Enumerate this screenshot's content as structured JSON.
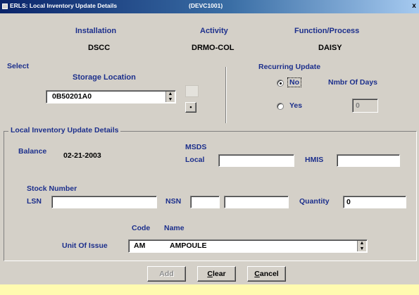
{
  "window": {
    "title": "ERLS: Local Inventory Update Details",
    "code": "(DEVC1001)",
    "close_glyph": "x"
  },
  "header": {
    "installation_label": "Installation",
    "installation_value": "DSCC",
    "activity_label": "Activity",
    "activity_value": "DRMO-COL",
    "function_label": "Function/Process",
    "function_value": "DAISY"
  },
  "select": {
    "group_label": "Select",
    "storage_label": "Storage Location",
    "storage_value": "0B50201A0",
    "more_button_glyph": "•"
  },
  "recurring": {
    "label": "Recurring Update",
    "no_label": "No",
    "yes_label": "Yes",
    "selected": "No",
    "days_label": "Nmbr Of Days",
    "days_value": "0"
  },
  "details": {
    "group_label": "Local Inventory Update Details",
    "balance_label": "Balance",
    "balance_value": "02-21-2003",
    "msds_label": "MSDS",
    "local_label": "Local",
    "local_value": "",
    "hmis_label": "HMIS",
    "hmis_value": "",
    "stock_number_label": "Stock Number",
    "lsn_label": "LSN",
    "lsn_value": "",
    "nsn_label": "NSN",
    "nsn_value_a": "",
    "nsn_value_b": "",
    "quantity_label": "Quantity",
    "quantity_value": "0",
    "code_label": "Code",
    "name_label": "Name",
    "unit_label": "Unit Of Issue",
    "unit_code": "AM",
    "unit_name": "AMPOULE"
  },
  "buttons": {
    "add": "Add",
    "clear_u": "C",
    "clear_rest": "lear",
    "cancel_u": "C",
    "cancel_rest": "ancel"
  },
  "icons": {
    "spin": "spin-arrows-icon",
    "radio": "radio-icon"
  }
}
